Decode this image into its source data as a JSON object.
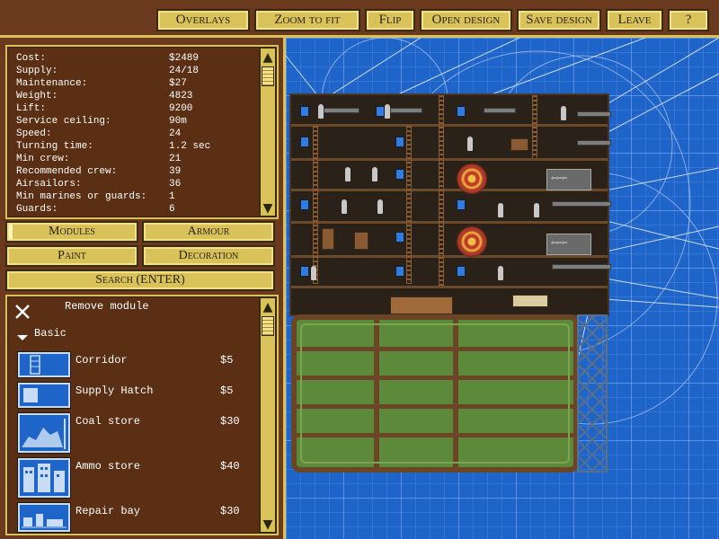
{
  "toolbar": {
    "overlays": "Overlays",
    "zoom_to_fit": "Zoom to fit",
    "flip": "Flip",
    "open_design": "Open design",
    "save_design": "Save design",
    "leave": "Leave",
    "help": "?"
  },
  "stats": [
    {
      "label": "Cost:",
      "value": "$2489"
    },
    {
      "label": "Supply:",
      "value": "24/18"
    },
    {
      "label": "Maintenance:",
      "value": "$27"
    },
    {
      "label": "Weight:",
      "value": "4823"
    },
    {
      "label": "Lift:",
      "value": "9200"
    },
    {
      "label": "Service ceiling:",
      "value": "90m"
    },
    {
      "label": "Speed:",
      "value": "24"
    },
    {
      "label": "Turning time:",
      "value": "1.2 sec"
    },
    {
      "label": "Min crew:",
      "value": "21"
    },
    {
      "label": "Recommended crew:",
      "value": "39"
    },
    {
      "label": "Airsailors:",
      "value": "36"
    },
    {
      "label": "Min marines or guards:",
      "value": "1"
    },
    {
      "label": "Guards:",
      "value": "6"
    }
  ],
  "tabs": {
    "modules": "Modules",
    "armour": "Armour",
    "paint": "Paint",
    "decoration": "Decoration",
    "search": "Search (ENTER)"
  },
  "module_list": {
    "remove": "Remove module",
    "category": "Basic",
    "items": [
      {
        "name": "Corridor",
        "price": "$5",
        "icon": "corridor-icon"
      },
      {
        "name": "Supply Hatch",
        "price": "$5",
        "icon": "supply-hatch-icon"
      },
      {
        "name": "Coal store",
        "price": "$30",
        "icon": "coal-store-icon"
      },
      {
        "name": "Ammo store",
        "price": "$40",
        "icon": "ammo-store-icon"
      },
      {
        "name": "Repair bay",
        "price": "$30",
        "icon": "repair-bay-icon"
      }
    ]
  },
  "colors": {
    "wood": "#6b3a1e",
    "gold": "#d9c25a",
    "blueprint": "#1f64c8",
    "balloon": "#5d8a3a"
  }
}
